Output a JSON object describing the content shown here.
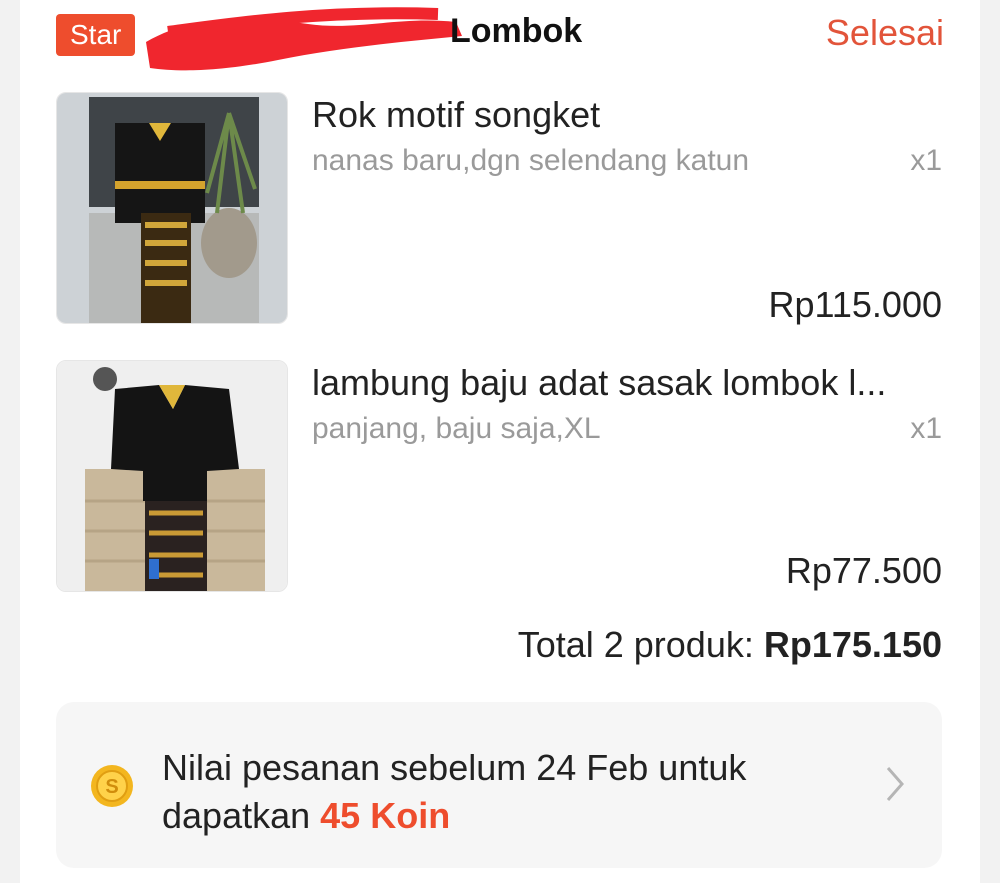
{
  "header": {
    "badge_label": "Star",
    "shop_name": "Lombok",
    "status": "Selesai"
  },
  "products": [
    {
      "name": "Rok motif songket",
      "variation": "nanas baru,dgn selendang katun",
      "qty": "x1",
      "price": "Rp115.000"
    },
    {
      "name": "lambung baju adat sasak lombok l...",
      "variation": "panjang, baju saja,XL",
      "qty": "x1",
      "price": "Rp77.500"
    }
  ],
  "total": {
    "label": "Total 2 produk:",
    "amount": "Rp175.150"
  },
  "coin_banner": {
    "line1": "Nilai pesanan sebelum 24 Feb untuk",
    "line2_prefix": "dapatkan",
    "highlight": "45 Koin"
  },
  "colors": {
    "accent": "#ee4d2d",
    "status": "#e2543a"
  },
  "icons": {
    "coin": "coin-icon",
    "chevron": "chevron-right-icon"
  }
}
